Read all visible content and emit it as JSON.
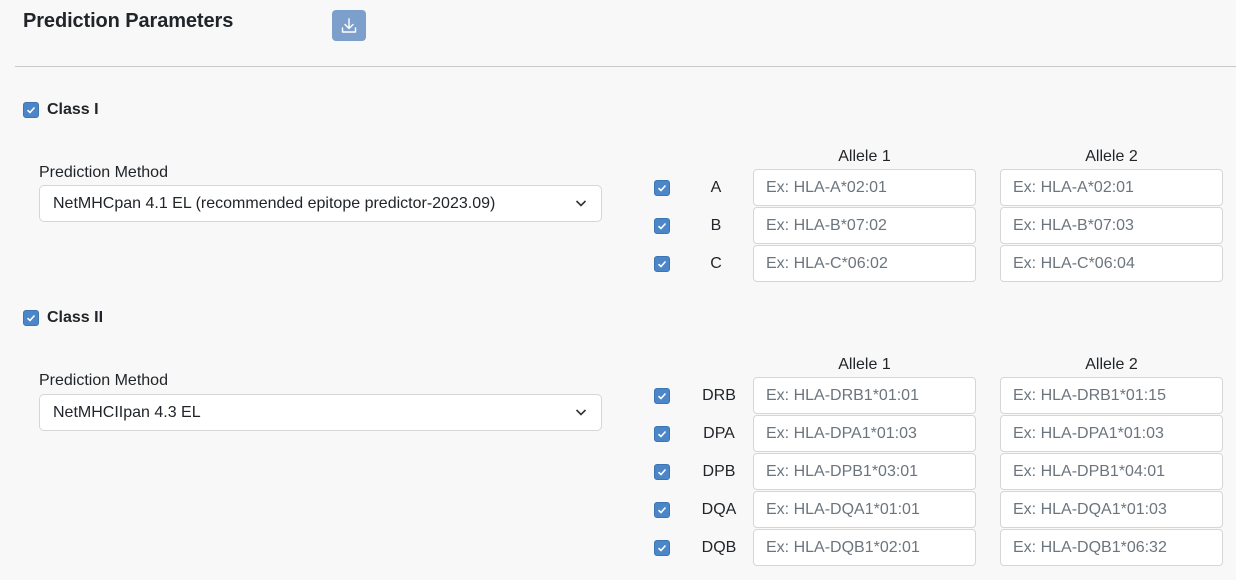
{
  "header": {
    "title": "Prediction Parameters",
    "download_icon": "download-icon"
  },
  "class_i": {
    "label": "Class I",
    "checked": true,
    "method_label": "Prediction Method",
    "method_value": "NetMHCpan 4.1 EL (recommended epitope predictor-2023.09)",
    "allele1_header": "Allele 1",
    "allele2_header": "Allele 2",
    "loci": [
      {
        "name": "A",
        "allele1_placeholder": "Ex: HLA-A*02:01",
        "allele2_placeholder": "Ex: HLA-A*02:01"
      },
      {
        "name": "B",
        "allele1_placeholder": "Ex: HLA-B*07:02",
        "allele2_placeholder": "Ex: HLA-B*07:03"
      },
      {
        "name": "C",
        "allele1_placeholder": "Ex: HLA-C*06:02",
        "allele2_placeholder": "Ex: HLA-C*06:04"
      }
    ]
  },
  "class_ii": {
    "label": "Class II",
    "checked": true,
    "method_label": "Prediction Method",
    "method_value": "NetMHCIIpan 4.3 EL",
    "allele1_header": "Allele 1",
    "allele2_header": "Allele 2",
    "loci": [
      {
        "name": "DRB",
        "allele1_placeholder": "Ex: HLA-DRB1*01:01",
        "allele2_placeholder": "Ex: HLA-DRB1*01:15"
      },
      {
        "name": "DPA",
        "allele1_placeholder": "Ex: HLA-DPA1*01:03",
        "allele2_placeholder": "Ex: HLA-DPA1*01:03"
      },
      {
        "name": "DPB",
        "allele1_placeholder": "Ex: HLA-DPB1*03:01",
        "allele2_placeholder": "Ex: HLA-DPB1*04:01"
      },
      {
        "name": "DQA",
        "allele1_placeholder": "Ex: HLA-DQA1*01:01",
        "allele2_placeholder": "Ex: HLA-DQA1*01:03"
      },
      {
        "name": "DQB",
        "allele1_placeholder": "Ex: HLA-DQB1*02:01",
        "allele2_placeholder": "Ex: HLA-DQB1*06:32"
      }
    ]
  },
  "colors": {
    "accent": "#4a86c8",
    "download_button": "#7c9fcc",
    "background": "#f8f8f8"
  }
}
